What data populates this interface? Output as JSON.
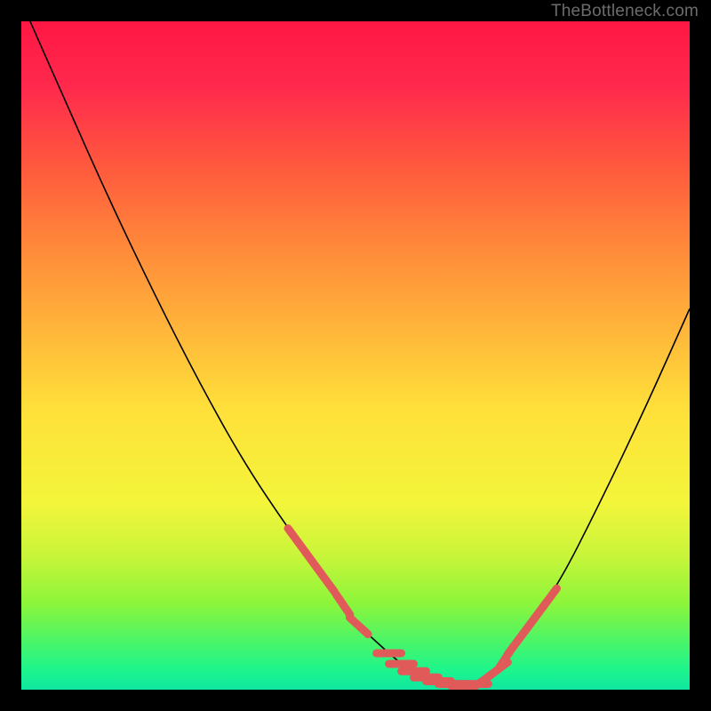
{
  "watermark": "TheBottleneck.com",
  "colors": {
    "background": "#000000",
    "watermark": "#6c6c6c",
    "curve": "#000000",
    "dash": "#e05a5a",
    "gradient_top": "#ff1744",
    "gradient_bottom": "#0fe6a0"
  },
  "chart_data": {
    "type": "line",
    "title": "",
    "xlabel": "",
    "ylabel": "",
    "xlim": [
      0,
      100
    ],
    "ylim": [
      0,
      100
    ],
    "series": [
      {
        "name": "curve",
        "x": [
          0,
          6.6,
          13.3,
          20,
          26.6,
          33.3,
          40,
          46.6,
          50,
          53.3,
          56.6,
          60,
          63.3,
          66.6,
          68.6,
          71.3,
          73.3,
          80,
          86.6,
          93.3,
          100
        ],
        "y": [
          103,
          88,
          73,
          59,
          46,
          34,
          24,
          15,
          10,
          7,
          4,
          2,
          1,
          0.5,
          1,
          3,
          6,
          15,
          28,
          42,
          57
        ]
      }
    ],
    "dash_regions": [
      {
        "name": "left-slope",
        "x_start": 41,
        "x_end": 50.5,
        "count": 5,
        "orientation": "tangent"
      },
      {
        "name": "valley-flat",
        "x_start": 55,
        "x_end": 68,
        "count": 8,
        "orientation": "flat"
      },
      {
        "name": "right-slope",
        "x_start": 70,
        "x_end": 79,
        "count": 8,
        "orientation": "tangent"
      }
    ]
  }
}
